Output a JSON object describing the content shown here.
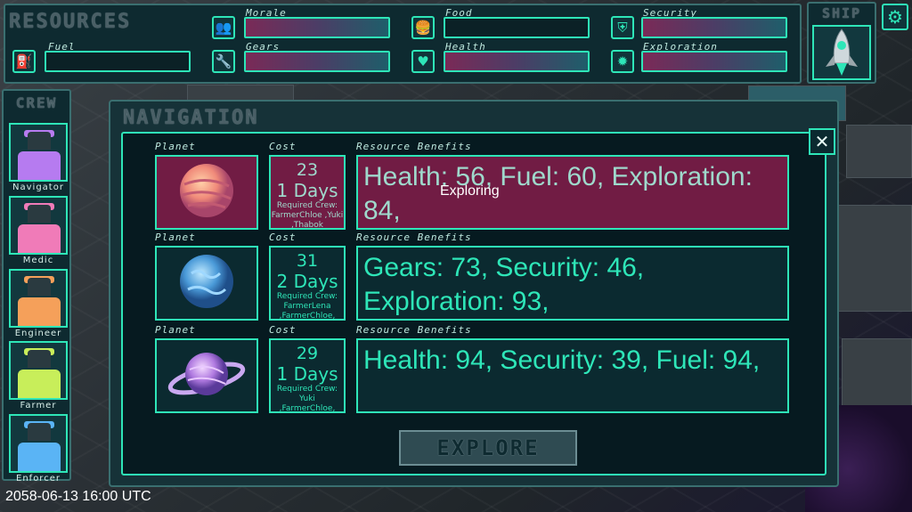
{
  "resources": {
    "title": "RESOURCES",
    "items": [
      {
        "label": "Fuel",
        "icon": "fuel-icon"
      },
      {
        "label": "Morale",
        "icon": "people-icon"
      },
      {
        "label": "Gears",
        "icon": "wrench-icon"
      },
      {
        "label": "Food",
        "icon": "burger-icon"
      },
      {
        "label": "Health",
        "icon": "heart-icon"
      },
      {
        "label": "Security",
        "icon": "shield-icon"
      },
      {
        "label": "Exploration",
        "icon": "compass-icon"
      }
    ]
  },
  "ship": {
    "title": "SHIP"
  },
  "crew": {
    "title": "CREW",
    "members": [
      {
        "role": "Navigator",
        "color": "#b67bf0"
      },
      {
        "role": "Medic",
        "color": "#f07bb8"
      },
      {
        "role": "Engineer",
        "color": "#f5a05a"
      },
      {
        "role": "Farmer",
        "color": "#c8ee5a"
      },
      {
        "role": "Enforcer",
        "color": "#5ab4f5"
      }
    ]
  },
  "navigation": {
    "title": "NAVIGATION",
    "col_planet": "Planet",
    "col_cost": "Cost",
    "col_benefits": "Resource Benefits",
    "status": "Exploring",
    "explore_label": "EXPLORE",
    "rows": [
      {
        "cost": "23",
        "days": "1 Days",
        "required": "Required Crew: FarmerChloe ,Yuki ,Thabok",
        "benefits": "Health: 56, Fuel: 60, Exploration: 84,",
        "planet": "pink-swirl-planet",
        "selected": true
      },
      {
        "cost": "31",
        "days": "2 Days",
        "required": "Required Crew: FarmerLena ,FarmerChloe, Thabok",
        "benefits": "Gears: 73, Security: 46, Exploration: 93,",
        "planet": "blue-ocean-planet",
        "selected": false
      },
      {
        "cost": "29",
        "days": "1 Days",
        "required": "Required Crew: Yuki ,FarmerChloe, Thabok",
        "benefits": "Health: 94, Security: 39, Fuel: 94,",
        "planet": "purple-ringed-planet",
        "selected": false
      }
    ]
  },
  "timestamp": "2058-06-13 16:00 UTC"
}
